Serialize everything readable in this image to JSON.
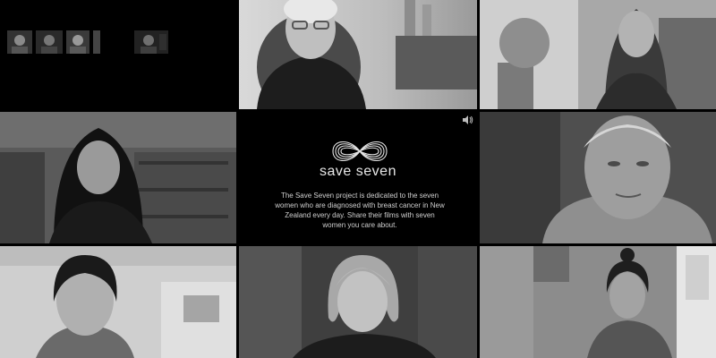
{
  "brand": {
    "name": "save seven",
    "description": "The Save Seven project is dedicated to the seven women who are diagnosed with breast cancer in New Zealand every day. Share their films with seven women you care about."
  },
  "icons": {
    "logo": "infinity-ribbon-logo",
    "sound": "speaker-icon"
  },
  "videos": [
    {
      "id": "thumb-strip",
      "kind": "thumbnail-strip"
    },
    {
      "id": "older-woman-glasses",
      "kind": "portrait"
    },
    {
      "id": "woman-long-hair-window",
      "kind": "portrait"
    },
    {
      "id": "woman-bookshelf",
      "kind": "portrait"
    },
    {
      "id": "woman-short-blonde-hair",
      "kind": "portrait"
    },
    {
      "id": "woman-dark-short-hair",
      "kind": "portrait"
    },
    {
      "id": "woman-blonde-bob",
      "kind": "portrait"
    },
    {
      "id": "woman-pink-shirt",
      "kind": "portrait"
    }
  ],
  "colors": {
    "background": "#000000",
    "text": "#cfcfcf"
  }
}
